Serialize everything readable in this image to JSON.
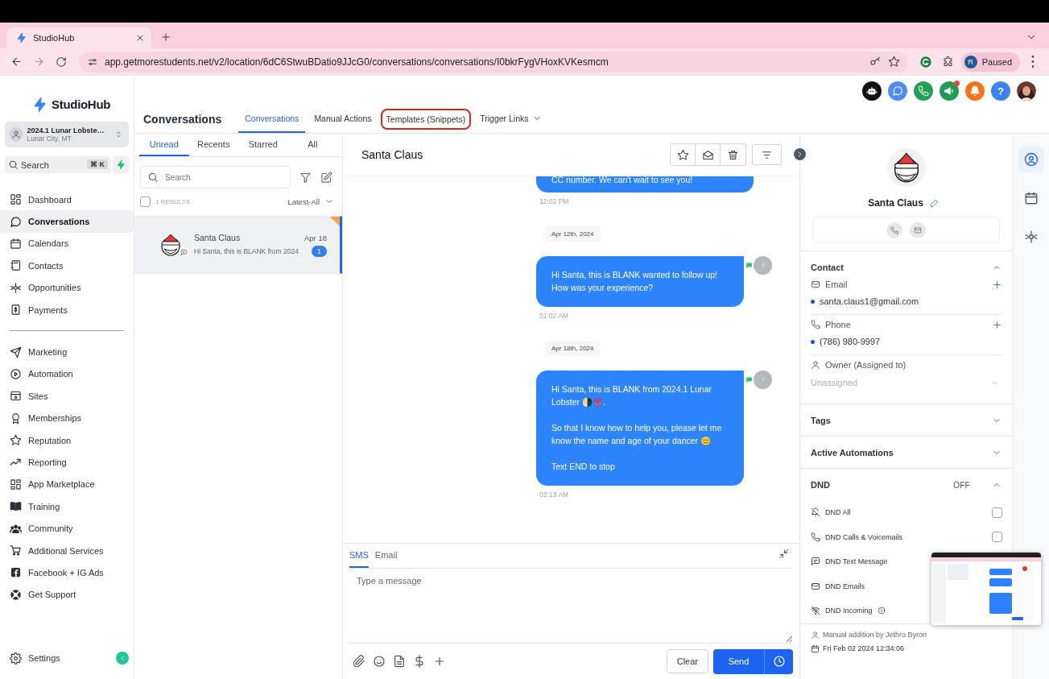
{
  "browser": {
    "tab_title": "StudioHub",
    "url": "app.getmorestudents.net/v2/location/6dC6StwuBDatio9JJcG0/conversations/conversations/I0bkrFygVHoxKVKesmcm",
    "profile_initial": "R",
    "profile_status": "Paused"
  },
  "sidebar": {
    "logo": "StudioHub",
    "account": {
      "name": "2024.1 Lunar Lobste…",
      "location": "Lunar City, MT"
    },
    "search": {
      "placeholder": "Search",
      "shortcut": "⌘ K"
    },
    "sections": [
      {
        "items": [
          {
            "label": "Dashboard",
            "selected": false
          },
          {
            "label": "Conversations",
            "selected": true
          },
          {
            "label": "Calendars",
            "selected": false
          },
          {
            "label": "Contacts",
            "selected": false
          },
          {
            "label": "Opportunities",
            "selected": false
          },
          {
            "label": "Payments",
            "selected": false
          }
        ]
      },
      {
        "items": [
          {
            "label": "Marketing",
            "selected": false
          },
          {
            "label": "Automation",
            "selected": false
          },
          {
            "label": "Sites",
            "selected": false
          },
          {
            "label": "Memberships",
            "selected": false
          },
          {
            "label": "Reputation",
            "selected": false
          },
          {
            "label": "Reporting",
            "selected": false
          },
          {
            "label": "App Marketplace",
            "selected": false
          },
          {
            "label": "Training",
            "selected": false
          },
          {
            "label": "Community",
            "selected": false
          },
          {
            "label": "Additional Services",
            "selected": false
          },
          {
            "label": "Facebook + IG Ads",
            "selected": false
          },
          {
            "label": "Get Support",
            "selected": false
          }
        ]
      }
    ],
    "settings": "Settings"
  },
  "header": {
    "title": "Conversations",
    "help": "?",
    "tabs": [
      {
        "label": "Conversations",
        "selected": true,
        "highlighted": false,
        "dropdown": false
      },
      {
        "label": "Manual Actions",
        "selected": false,
        "highlighted": false,
        "dropdown": false
      },
      {
        "label": "Templates (Snippets)",
        "selected": false,
        "highlighted": true,
        "dropdown": false
      },
      {
        "label": "Trigger Links",
        "selected": false,
        "highlighted": false,
        "dropdown": true
      }
    ]
  },
  "conversation_list": {
    "tabs": [
      {
        "label": "Unread",
        "selected": true
      },
      {
        "label": "Recents",
        "selected": false
      },
      {
        "label": "Starred",
        "selected": false
      },
      {
        "label": "All",
        "selected": false
      }
    ],
    "search": {
      "placeholder": "Search"
    },
    "results": "1 RESULTS",
    "select_all": false,
    "sort": "Latest-All",
    "items": [
      {
        "name": "Santa Claus",
        "date": "Apr 18",
        "preview": "Hi Santa, this is BLANK from 2024",
        "unread": "1",
        "selected": true,
        "starred": true
      }
    ]
  },
  "chat": {
    "contact": "Santa Claus",
    "messages": [
      {
        "kind": "message",
        "text": "CC number. We can't wait to see you!",
        "time": "12:02 PM",
        "cut_off": true
      },
      {
        "kind": "date",
        "text": "Apr 12th, 2024"
      },
      {
        "kind": "message",
        "text": "Hi Santa, this is BLANK wanted to follow up! How was your experience?",
        "time": "01:02 AM",
        "cut_off": false,
        "avatar": "?"
      },
      {
        "kind": "date",
        "text": "Apr 18th, 2024"
      },
      {
        "kind": "message",
        "text": "Hi Santa, this is BLANK from 2024.1 Lunar Lobster 🌗🦞.\n\nSo that I know how to help you, please let me know the name and age of your dancer 😊\n\nText END to stop",
        "time": "02:13 AM",
        "cut_off": false,
        "avatar": "?"
      }
    ],
    "composer": {
      "tabs": [
        {
          "label": "SMS",
          "selected": true
        },
        {
          "label": "Email",
          "selected": false
        }
      ],
      "placeholder": "Type a message",
      "clear": "Clear",
      "send": "Send"
    }
  },
  "contact": {
    "name": "Santa Claus",
    "sections": [
      {
        "kind": "contact",
        "title": "Contact",
        "expanded": true,
        "email_label": "Email",
        "email": "santa.claus1@gmail.com",
        "phone_label": "Phone",
        "phone": "(786) 980-9997",
        "owner_label": "Owner (Assigned to)",
        "owner_placeholder": "Unassigned"
      },
      {
        "title": "Tags",
        "expanded": false
      },
      {
        "title": "Active Automations",
        "expanded": false
      },
      {
        "kind": "dnd",
        "title": "DND",
        "expanded": true,
        "status": "OFF",
        "options": [
          {
            "label": "DND All",
            "checked": false,
            "info": false
          },
          {
            "label": "DND Calls & Voicemails",
            "checked": false,
            "info": false
          },
          {
            "label": "DND Text Message",
            "info": false
          },
          {
            "label": "DND Emails",
            "info": false
          },
          {
            "label": "DND Incoming",
            "info": true
          }
        ]
      }
    ],
    "created_by": "Manual addition by Jethro Byron",
    "created_at": "Fri Feb 02 2024 12:34:06"
  },
  "rail": [
    {
      "selected": true
    },
    {
      "selected": false
    },
    {
      "selected": false
    }
  ]
}
